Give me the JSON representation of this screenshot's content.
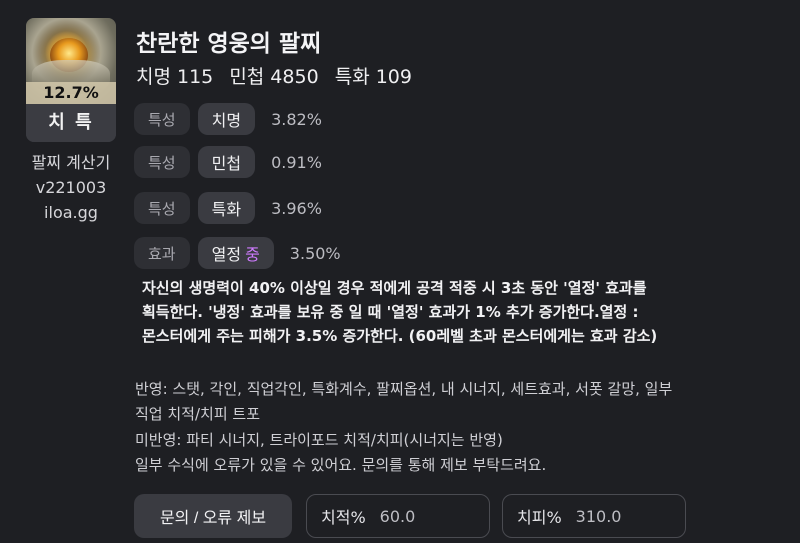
{
  "item": {
    "percent": "12.7%",
    "grade": "치 특",
    "calculator": [
      "팔찌 계산기",
      "v221003",
      "iloa.gg"
    ]
  },
  "title": "찬란한 영웅의 팔찌",
  "stats": [
    "치명 115",
    "민첩 4850",
    "특화 109"
  ],
  "traits": [
    {
      "tag": "특성",
      "name": "치명",
      "value": "3.82%"
    },
    {
      "tag": "특성",
      "name": "민첩",
      "value": "0.91%"
    },
    {
      "tag": "특성",
      "name": "특화",
      "value": "3.96%"
    }
  ],
  "effect": {
    "tag": "효과",
    "name": "열정",
    "level": "중",
    "value": "3.50%"
  },
  "effect_desc": [
    "자신의 생명력이 40% 이상일 경우 적에게 공격 적중 시 3초 동안 '열정' 효과를",
    "획득한다. '냉정' 효과를 보유 중 일 때 '열정' 효과가 1% 추가 증가한다.열정 :",
    "몬스터에게 주는 피해가 3.5% 증가한다. (60레벨 초과 몬스터에게는 효과 감소)"
  ],
  "notes": [
    "반영: 스탯, 각인, 직업각인, 특화계수, 팔찌옵션, 내 시너지, 세트효과, 서폿 갈망, 일부",
    "직업 치적/치피 트포",
    "미반영: 파티 시너지, 트라이포드 치적/치피(시너지는 반영)",
    "일부 수식에 오류가 있을 수 있어요. 문의를 통해 제보 부탁드려요."
  ],
  "buttons": {
    "report": "문의 / 오류 제보"
  },
  "fields": {
    "crit_rate_label": "치적%",
    "crit_rate_value": "60.0",
    "crit_dmg_label": "치피%",
    "crit_dmg_value": "310.0"
  }
}
